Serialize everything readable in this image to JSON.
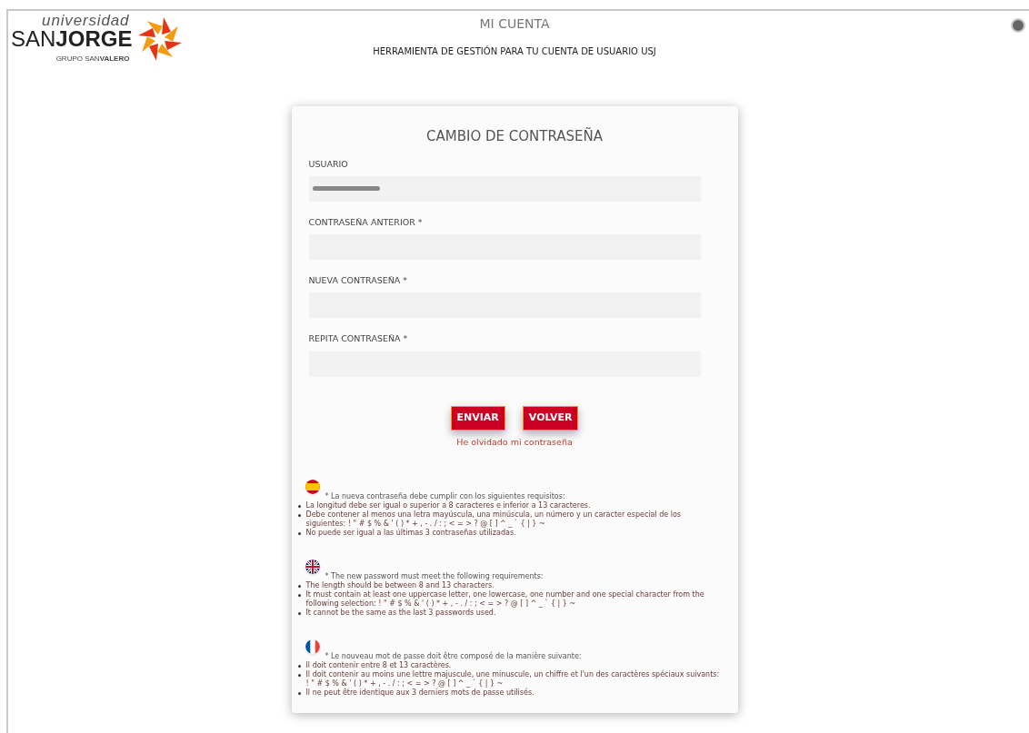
{
  "logo": {
    "top": "universidad",
    "main": "SAN**JORGE**",
    "sub": "GRUPO SAN**VALERO**"
  },
  "header": {
    "title": "MI CUENTA",
    "subtitle": "HERRAMIENTA DE GESTIÓN PARA TU CUENTA DE USUARIO USJ"
  },
  "form": {
    "title": "CAMBIO DE CONTRASEÑA",
    "fields": [
      {
        "label": "USUARIO",
        "redacted": true
      },
      {
        "label": "CONTRASEÑA ANTERIOR *",
        "redacted": false
      },
      {
        "label": "NUEVA CONTRASEÑA *",
        "redacted": false
      },
      {
        "label": "REPITA CONTRASEÑA *",
        "redacted": false
      }
    ],
    "buttons": [
      "ENVIAR",
      "VOLVER"
    ],
    "link": "He olvidado mi contraseña"
  },
  "requirements": [
    {
      "kind": "es",
      "intro": "* La nueva contraseña debe cumplir con los siguientes requisitos:",
      "items": [
        "La longitud debe ser igual o superior a 8 caracteres e inferior a 13 caracteres.",
        "Debe contener al menos una letra mayúscula, una minúscula, un número y un caracter especial de los siguientes: ! \" # $ % & ' ( ) * + , - . / : ; < = > ? @ [ ] ^ _ ` { | } ~",
        "No puede ser igual a las últimas 3 contraseñas utilizadas."
      ]
    },
    {
      "kind": "gb",
      "intro": "* The new password must meet the following requirements:",
      "items": [
        "The length should be between 8 and 13 characters.",
        "It must contain at least one uppercase letter, one lowercase, one number and one special character from the following selection: ! \" # $ % & ' ( ) * + , - . / : ; < = > ? @ [ ] ^ _ ` { | } ~",
        "It cannot be the same as the last 3 passwords used."
      ]
    },
    {
      "kind": "fr",
      "intro": "* Le nouveau mot de passe doit être composé de la manière suivante:",
      "items": [
        "Il doit contenir entre 8 et 13 caractères.",
        "Il doit contenir au moins une lettre majuscule, une minuscule, un chiffre et l'un des caractères spéciaux suivants: ! \" # $ % & ' ( ) * + , - . / : ; < = > ? @ [ ] ^ _ ` { | } ~",
        "Il ne peut être identique aux 3 derniers mots de passe utilisés."
      ]
    }
  ]
}
